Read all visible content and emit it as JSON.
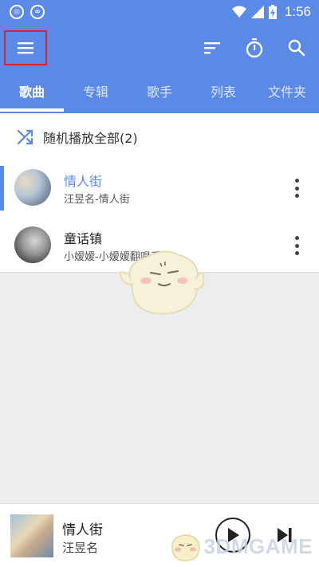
{
  "status_bar": {
    "time": "1:56",
    "icons": [
      "circle-app-icon",
      "infinity-app-icon",
      "wifi-icon",
      "signal-icon",
      "battery-charging-icon"
    ],
    "app_icon_1_glyph": "◎",
    "app_icon_2_glyph": "∞"
  },
  "toolbar": {
    "icons": [
      "menu-icon",
      "sort-icon",
      "timer-icon",
      "search-icon"
    ],
    "highlight_color": "#d9232b",
    "accent": "#5a89e6"
  },
  "tabs": [
    {
      "label": "歌曲",
      "active": true
    },
    {
      "label": "专辑",
      "active": false
    },
    {
      "label": "歌手",
      "active": false
    },
    {
      "label": "列表",
      "active": false
    },
    {
      "label": "文件夹",
      "active": false
    }
  ],
  "shuffle": {
    "label": "随机播放全部(2)"
  },
  "songs": [
    {
      "title": "情人街",
      "subtitle": "汪昱名-情人街",
      "playing": true
    },
    {
      "title": "童话镇",
      "subtitle": "小嫒嫒-小嫒嫒翻唱系列",
      "playing": false
    }
  ],
  "now_playing": {
    "title": "情人街",
    "artist": "汪昱名"
  },
  "watermark": {
    "text": "3DMGAME"
  }
}
